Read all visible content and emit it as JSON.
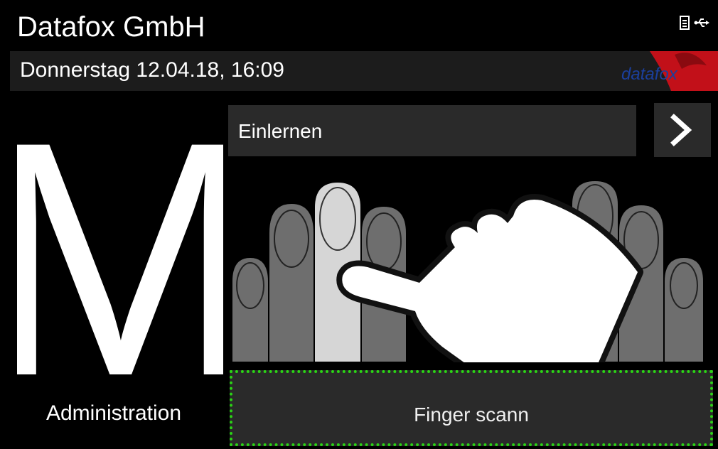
{
  "header": {
    "title": "Datafox GmbH",
    "date_line": "Donnerstag  12.04.18, 16:09",
    "logo_text": "datafox",
    "status_icons": [
      "document-icon",
      "usb-icon"
    ]
  },
  "mode": {
    "letter": "M",
    "label": "Administration"
  },
  "function": {
    "label": "Einlernen"
  },
  "scan_button": {
    "label": "Finger scann"
  },
  "colors": {
    "background": "#000000",
    "panel": "#2a2a2a",
    "focus_outline": "#2bd315",
    "logo_red": "#d1121c",
    "logo_blue": "#1b3f9c"
  }
}
